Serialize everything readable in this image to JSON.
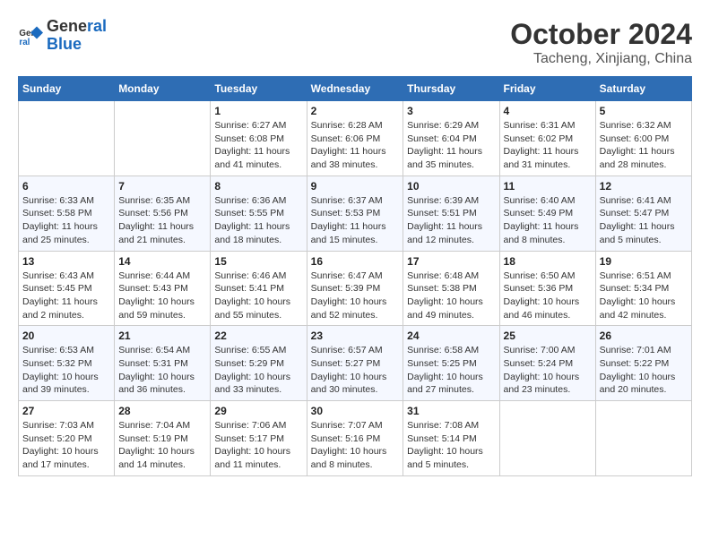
{
  "header": {
    "logo_line1": "General",
    "logo_line2": "Blue",
    "month": "October 2024",
    "location": "Tacheng, Xinjiang, China"
  },
  "days_of_week": [
    "Sunday",
    "Monday",
    "Tuesday",
    "Wednesday",
    "Thursday",
    "Friday",
    "Saturday"
  ],
  "weeks": [
    [
      {
        "num": "",
        "sunrise": "",
        "sunset": "",
        "daylight": ""
      },
      {
        "num": "",
        "sunrise": "",
        "sunset": "",
        "daylight": ""
      },
      {
        "num": "1",
        "sunrise": "Sunrise: 6:27 AM",
        "sunset": "Sunset: 6:08 PM",
        "daylight": "Daylight: 11 hours and 41 minutes."
      },
      {
        "num": "2",
        "sunrise": "Sunrise: 6:28 AM",
        "sunset": "Sunset: 6:06 PM",
        "daylight": "Daylight: 11 hours and 38 minutes."
      },
      {
        "num": "3",
        "sunrise": "Sunrise: 6:29 AM",
        "sunset": "Sunset: 6:04 PM",
        "daylight": "Daylight: 11 hours and 35 minutes."
      },
      {
        "num": "4",
        "sunrise": "Sunrise: 6:31 AM",
        "sunset": "Sunset: 6:02 PM",
        "daylight": "Daylight: 11 hours and 31 minutes."
      },
      {
        "num": "5",
        "sunrise": "Sunrise: 6:32 AM",
        "sunset": "Sunset: 6:00 PM",
        "daylight": "Daylight: 11 hours and 28 minutes."
      }
    ],
    [
      {
        "num": "6",
        "sunrise": "Sunrise: 6:33 AM",
        "sunset": "Sunset: 5:58 PM",
        "daylight": "Daylight: 11 hours and 25 minutes."
      },
      {
        "num": "7",
        "sunrise": "Sunrise: 6:35 AM",
        "sunset": "Sunset: 5:56 PM",
        "daylight": "Daylight: 11 hours and 21 minutes."
      },
      {
        "num": "8",
        "sunrise": "Sunrise: 6:36 AM",
        "sunset": "Sunset: 5:55 PM",
        "daylight": "Daylight: 11 hours and 18 minutes."
      },
      {
        "num": "9",
        "sunrise": "Sunrise: 6:37 AM",
        "sunset": "Sunset: 5:53 PM",
        "daylight": "Daylight: 11 hours and 15 minutes."
      },
      {
        "num": "10",
        "sunrise": "Sunrise: 6:39 AM",
        "sunset": "Sunset: 5:51 PM",
        "daylight": "Daylight: 11 hours and 12 minutes."
      },
      {
        "num": "11",
        "sunrise": "Sunrise: 6:40 AM",
        "sunset": "Sunset: 5:49 PM",
        "daylight": "Daylight: 11 hours and 8 minutes."
      },
      {
        "num": "12",
        "sunrise": "Sunrise: 6:41 AM",
        "sunset": "Sunset: 5:47 PM",
        "daylight": "Daylight: 11 hours and 5 minutes."
      }
    ],
    [
      {
        "num": "13",
        "sunrise": "Sunrise: 6:43 AM",
        "sunset": "Sunset: 5:45 PM",
        "daylight": "Daylight: 11 hours and 2 minutes."
      },
      {
        "num": "14",
        "sunrise": "Sunrise: 6:44 AM",
        "sunset": "Sunset: 5:43 PM",
        "daylight": "Daylight: 10 hours and 59 minutes."
      },
      {
        "num": "15",
        "sunrise": "Sunrise: 6:46 AM",
        "sunset": "Sunset: 5:41 PM",
        "daylight": "Daylight: 10 hours and 55 minutes."
      },
      {
        "num": "16",
        "sunrise": "Sunrise: 6:47 AM",
        "sunset": "Sunset: 5:39 PM",
        "daylight": "Daylight: 10 hours and 52 minutes."
      },
      {
        "num": "17",
        "sunrise": "Sunrise: 6:48 AM",
        "sunset": "Sunset: 5:38 PM",
        "daylight": "Daylight: 10 hours and 49 minutes."
      },
      {
        "num": "18",
        "sunrise": "Sunrise: 6:50 AM",
        "sunset": "Sunset: 5:36 PM",
        "daylight": "Daylight: 10 hours and 46 minutes."
      },
      {
        "num": "19",
        "sunrise": "Sunrise: 6:51 AM",
        "sunset": "Sunset: 5:34 PM",
        "daylight": "Daylight: 10 hours and 42 minutes."
      }
    ],
    [
      {
        "num": "20",
        "sunrise": "Sunrise: 6:53 AM",
        "sunset": "Sunset: 5:32 PM",
        "daylight": "Daylight: 10 hours and 39 minutes."
      },
      {
        "num": "21",
        "sunrise": "Sunrise: 6:54 AM",
        "sunset": "Sunset: 5:31 PM",
        "daylight": "Daylight: 10 hours and 36 minutes."
      },
      {
        "num": "22",
        "sunrise": "Sunrise: 6:55 AM",
        "sunset": "Sunset: 5:29 PM",
        "daylight": "Daylight: 10 hours and 33 minutes."
      },
      {
        "num": "23",
        "sunrise": "Sunrise: 6:57 AM",
        "sunset": "Sunset: 5:27 PM",
        "daylight": "Daylight: 10 hours and 30 minutes."
      },
      {
        "num": "24",
        "sunrise": "Sunrise: 6:58 AM",
        "sunset": "Sunset: 5:25 PM",
        "daylight": "Daylight: 10 hours and 27 minutes."
      },
      {
        "num": "25",
        "sunrise": "Sunrise: 7:00 AM",
        "sunset": "Sunset: 5:24 PM",
        "daylight": "Daylight: 10 hours and 23 minutes."
      },
      {
        "num": "26",
        "sunrise": "Sunrise: 7:01 AM",
        "sunset": "Sunset: 5:22 PM",
        "daylight": "Daylight: 10 hours and 20 minutes."
      }
    ],
    [
      {
        "num": "27",
        "sunrise": "Sunrise: 7:03 AM",
        "sunset": "Sunset: 5:20 PM",
        "daylight": "Daylight: 10 hours and 17 minutes."
      },
      {
        "num": "28",
        "sunrise": "Sunrise: 7:04 AM",
        "sunset": "Sunset: 5:19 PM",
        "daylight": "Daylight: 10 hours and 14 minutes."
      },
      {
        "num": "29",
        "sunrise": "Sunrise: 7:06 AM",
        "sunset": "Sunset: 5:17 PM",
        "daylight": "Daylight: 10 hours and 11 minutes."
      },
      {
        "num": "30",
        "sunrise": "Sunrise: 7:07 AM",
        "sunset": "Sunset: 5:16 PM",
        "daylight": "Daylight: 10 hours and 8 minutes."
      },
      {
        "num": "31",
        "sunrise": "Sunrise: 7:08 AM",
        "sunset": "Sunset: 5:14 PM",
        "daylight": "Daylight: 10 hours and 5 minutes."
      },
      {
        "num": "",
        "sunrise": "",
        "sunset": "",
        "daylight": ""
      },
      {
        "num": "",
        "sunrise": "",
        "sunset": "",
        "daylight": ""
      }
    ]
  ]
}
